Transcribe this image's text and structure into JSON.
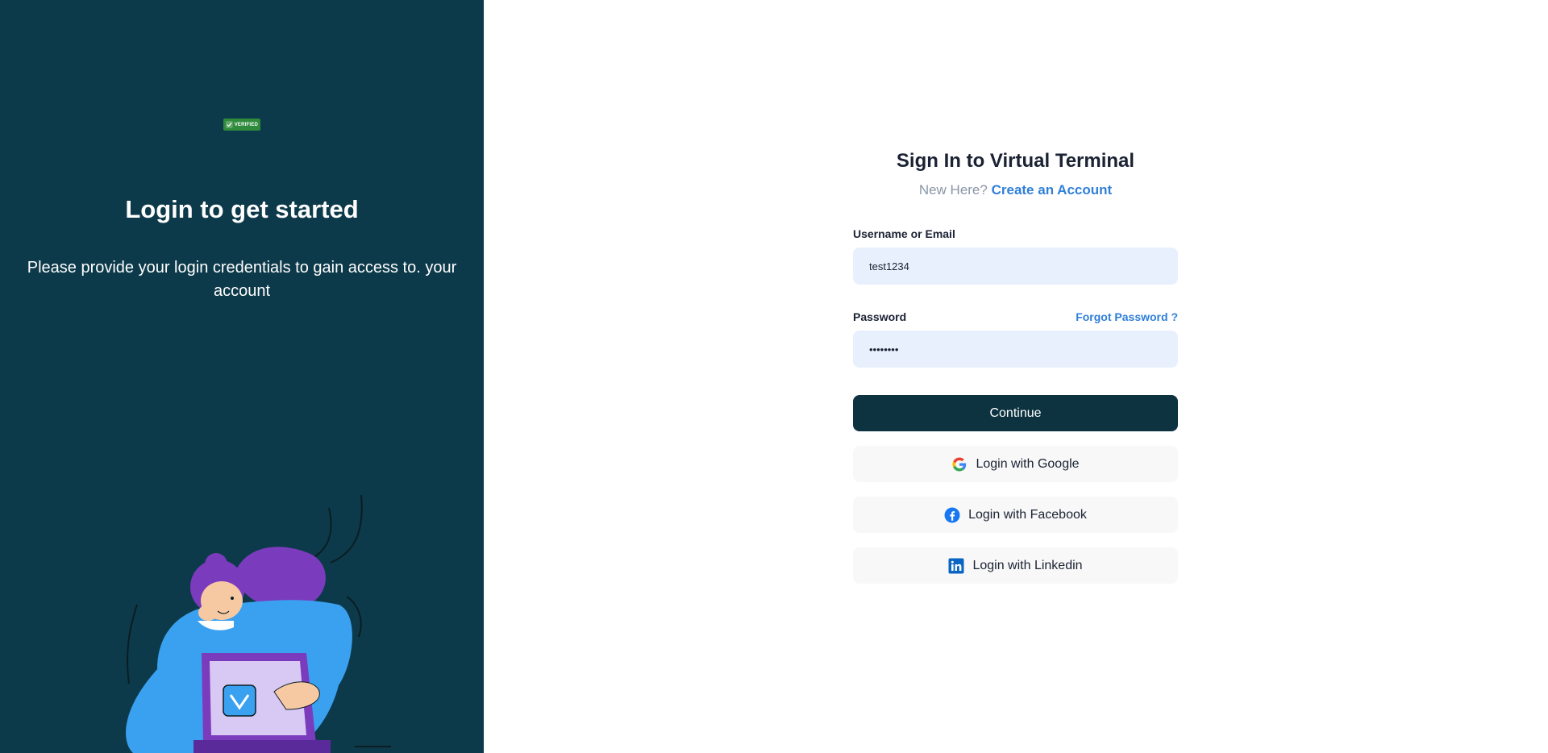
{
  "left_panel": {
    "badge_text": "VERIFIED",
    "heading": "Login to get started",
    "subtext": "Please provide your login credentials to gain access to. your account"
  },
  "form": {
    "title": "Sign In to Virtual Terminal",
    "new_here": "New Here?",
    "create_account": "Create an Account",
    "username_label": "Username or Email",
    "username_value": "test1234",
    "password_label": "Password",
    "forgot_password": "Forgot Password ?",
    "password_value": "test1234",
    "continue_label": "Continue"
  },
  "social": {
    "google": "Login with Google",
    "facebook": "Login with Facebook",
    "linkedin": "Login with Linkedin"
  },
  "colors": {
    "left_bg": "#0d3a4a",
    "primary_button": "#0d3340",
    "link": "#2f7fd9",
    "input_bg": "#e8f0fe",
    "social_bg": "#f8f8f8"
  },
  "icons": {
    "badge": "check-icon",
    "google": "google-icon",
    "facebook": "facebook-icon",
    "linkedin": "linkedin-icon"
  }
}
